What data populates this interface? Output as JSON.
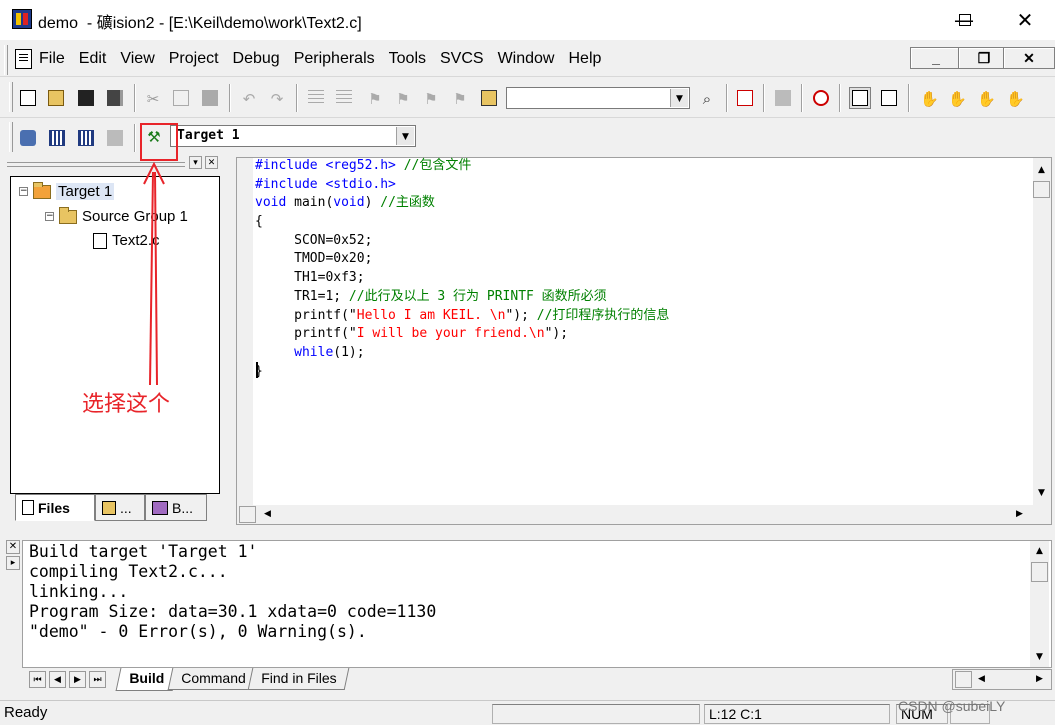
{
  "window": {
    "title": "demo  - 礦ision2 - [E:\\Keil\\demo\\work\\Text2.c]",
    "minimize_glyph": "—",
    "maximize_glyph": "☐",
    "close_glyph": "✕"
  },
  "menu": {
    "items": [
      "File",
      "Edit",
      "View",
      "Project",
      "Debug",
      "Peripherals",
      "Tools",
      "SVCS",
      "Window",
      "Help"
    ],
    "mdi_buttons": [
      "_",
      "❐",
      "✕"
    ]
  },
  "toolbar": {
    "find_combo_value": "",
    "target_combo_value": "Target 1"
  },
  "project": {
    "tree": [
      {
        "label": "Target 1",
        "toggle": "−"
      },
      {
        "label": "Source Group 1",
        "toggle": "−"
      },
      {
        "label": "Text2.c"
      }
    ],
    "tabs": [
      "Files",
      "...",
      "B..."
    ]
  },
  "editor": {
    "lines": [
      [
        {
          "t": "#include <reg52.h> ",
          "c": "kw"
        },
        {
          "t": "//包含文件",
          "c": "cm"
        }
      ],
      [
        {
          "t": "#include <stdio.h>",
          "c": "kw"
        }
      ],
      [
        {
          "t": "void ",
          "c": "kw"
        },
        {
          "t": "main(",
          "c": ""
        },
        {
          "t": "void",
          "c": "kw"
        },
        {
          "t": ") ",
          "c": ""
        },
        {
          "t": "//主函数",
          "c": "cm"
        }
      ],
      [
        {
          "t": "{",
          "c": ""
        }
      ],
      [
        {
          "t": "     SCON=0x52;",
          "c": ""
        }
      ],
      [
        {
          "t": "     TMOD=0x20;",
          "c": ""
        }
      ],
      [
        {
          "t": "     TH1=0xf3;",
          "c": ""
        }
      ],
      [
        {
          "t": "     TR1=1; ",
          "c": ""
        },
        {
          "t": "//此行及以上 3 行为 PRINTF 函数所必须",
          "c": "cm"
        }
      ],
      [
        {
          "t": "     printf(\"",
          "c": ""
        },
        {
          "t": "Hello I am KEIL. \\n",
          "c": "st"
        },
        {
          "t": "\"); ",
          "c": ""
        },
        {
          "t": "//打印程序执行的信息",
          "c": "cm"
        }
      ],
      [
        {
          "t": "     printf(\"",
          "c": ""
        },
        {
          "t": "I will be your friend.\\n",
          "c": "st"
        },
        {
          "t": "\");",
          "c": ""
        }
      ],
      [
        {
          "t": "     ",
          "c": ""
        },
        {
          "t": "while",
          "c": "kw"
        },
        {
          "t": "(1);",
          "c": ""
        }
      ],
      [
        {
          "t": "}",
          "c": ""
        }
      ]
    ]
  },
  "output": {
    "lines": [
      "Build target 'Target 1'",
      "compiling Text2.c...",
      "linking...",
      "Program Size: data=30.1 xdata=0 code=1130",
      "\"demo\" - 0 Error(s), 0 Warning(s)."
    ],
    "tabs": [
      "Build",
      "Command",
      "Find in Files"
    ]
  },
  "status": {
    "ready": "Ready",
    "position": "L:12 C:1",
    "num": "NUM"
  },
  "annotation": {
    "text": "选择这个",
    "color": "#e8242a"
  },
  "watermark": "CSDN @subeiLY",
  "colors": {
    "keyword": "#0000ff",
    "comment": "#008000",
    "string": "#ff0000"
  }
}
